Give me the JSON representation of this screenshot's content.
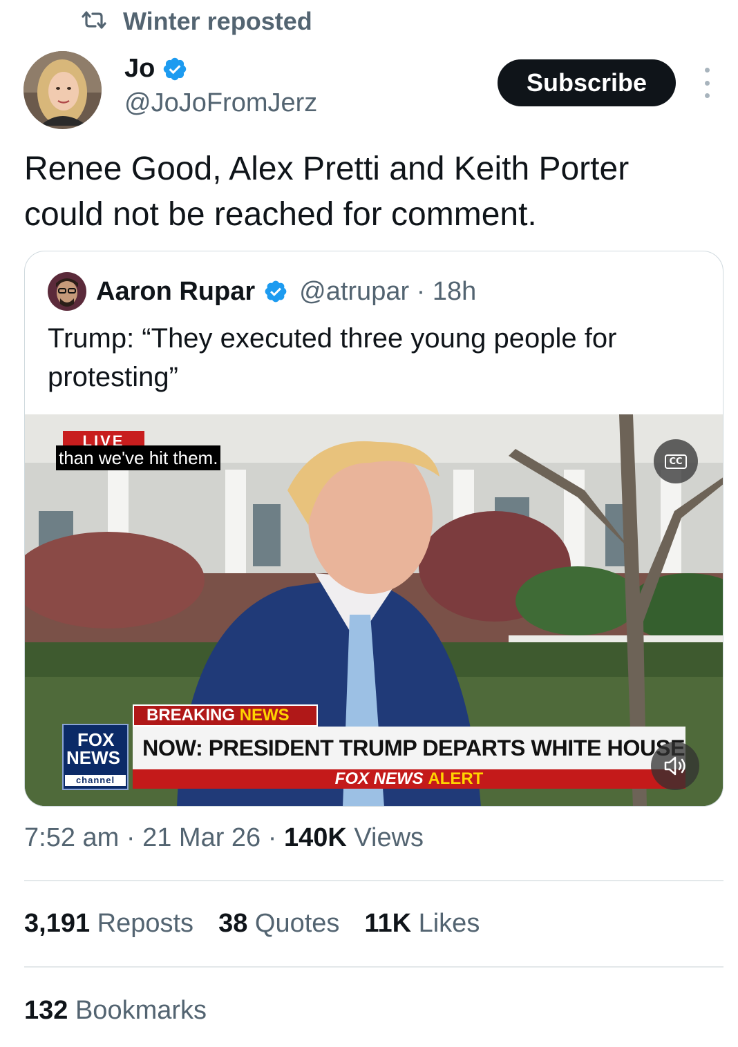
{
  "repost": {
    "icon": "repost-icon",
    "text": "Winter reposted"
  },
  "author": {
    "name": "Jo",
    "handle": "@JoJoFromJerz",
    "verified_icon": "verified-badge-icon",
    "verified_color": "#1d9bf0"
  },
  "subscribe_label": "Subscribe",
  "more_icon": "more-vertical-icon",
  "tweet_text": "Renee Good, Alex Pretti and Keith Porter could not be reached for comment.",
  "quote": {
    "name": "Aaron Rupar",
    "handle": "@atrupar · 18h",
    "text": "Trump: “They executed three young people for protesting”",
    "video": {
      "live_tag": "LIVE",
      "caption": "than we've hit them.",
      "cc_label": "CC",
      "channel_logo": {
        "line1": "FOX",
        "line2": "NEWS",
        "line3": "channel"
      },
      "breaking_prefix": "BREAKING",
      "breaking_suffix": "NEWS",
      "headline": "NOW: PRESIDENT TRUMP DEPARTS WHITE HOUSE",
      "alert_prefix": "FOX NEWS",
      "alert_suffix": "ALERT",
      "volume_icon": "volume-muted-icon"
    }
  },
  "meta": {
    "time": "7:52 am",
    "sep1": " · ",
    "date": "21 Mar 26",
    "sep2": " · ",
    "views_count": "140K",
    "views_label": " Views"
  },
  "stats": {
    "reposts_count": "3,191",
    "reposts_label": " Reposts",
    "quotes_count": "38",
    "quotes_label": " Quotes",
    "likes_count": "11K",
    "likes_label": " Likes"
  },
  "bookmarks": {
    "count": "132",
    "label": " Bookmarks"
  },
  "colors": {
    "text_primary": "#0f1419",
    "text_secondary": "#536471",
    "brand_blue": "#1d9bf0",
    "divider": "#e3e8ea"
  }
}
